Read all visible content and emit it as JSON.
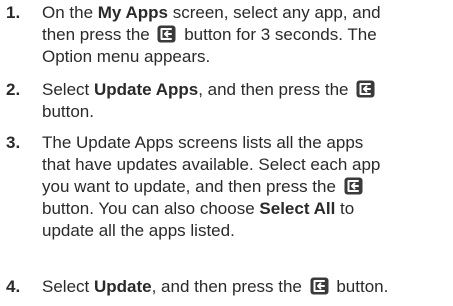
{
  "steps": [
    {
      "num": "1.",
      "lines": [
        [
          "On the ",
          {
            "b": "My Apps"
          },
          " screen, select any app, and"
        ],
        [
          "then press the ",
          {
            "icon": "enter-icon"
          },
          " button for 3 seconds. The"
        ],
        [
          "Option menu appears."
        ]
      ]
    },
    {
      "num": "2.",
      "lines": [
        [
          "Select ",
          {
            "b": "Update Apps"
          },
          ", and then press the ",
          {
            "icon": "enter-icon"
          }
        ],
        [
          "button."
        ]
      ]
    },
    {
      "num": "3.",
      "lines": [
        [
          "The Update Apps screens lists all the apps"
        ],
        [
          "that have updates available. Select each app"
        ],
        [
          "you want to update, and then press the ",
          {
            "icon": "enter-icon"
          }
        ],
        [
          "button. You can also choose ",
          {
            "b": "Select All"
          },
          " to"
        ],
        [
          "update all the apps listed."
        ]
      ]
    },
    {
      "num": "4.",
      "lines": [
        [
          "Select ",
          {
            "b": "Update"
          },
          ", and then press the ",
          {
            "icon": "enter-icon"
          },
          " button."
        ]
      ]
    }
  ],
  "colors": {
    "text": "#2a2a2a",
    "icon_bg": "#3a3a3a",
    "icon_fg": "#ffffff"
  }
}
